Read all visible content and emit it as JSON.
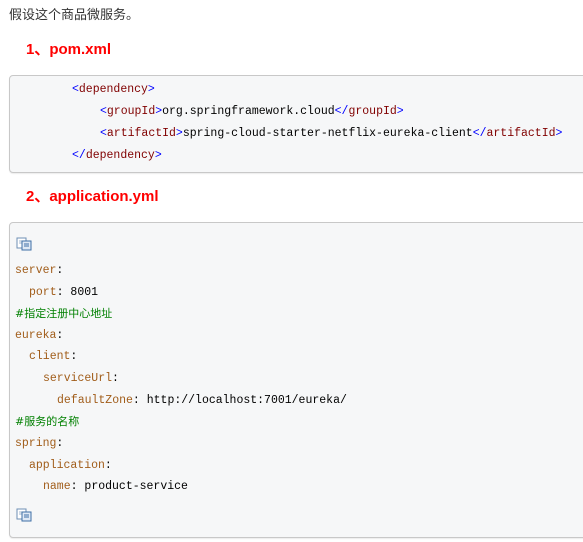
{
  "intro": "假设这个商品微服务。",
  "sections": [
    {
      "title": "1、pom.xml"
    },
    {
      "title": "2、application.yml"
    }
  ],
  "pom": {
    "dependency_tag": "dependency",
    "groupId_tag": "groupId",
    "groupId_value": "org.springframework.cloud",
    "artifactId_tag": "artifactId",
    "artifactId_value": "spring-cloud-starter-netflix-eureka-client"
  },
  "yml": {
    "server_key": "server",
    "port_key": "port",
    "port_value": "8001",
    "comment_registry": "#指定注册中心地址",
    "eureka_key": "eureka",
    "client_key": "client",
    "serviceUrl_key": "serviceUrl",
    "defaultZone_key": "defaultZone",
    "defaultZone_value": "http://localhost:7001/eureka/",
    "comment_service_name": "#服务的名称",
    "spring_key": "spring",
    "application_key": "application",
    "name_key": "name",
    "name_value": "product-service"
  },
  "icons": {
    "copy_top": "copy-code-icon",
    "copy_bottom": "copy-code-icon"
  },
  "colors": {
    "section_title": "#ff0000",
    "xml_bracket": "#0000ff",
    "xml_tag": "#800000",
    "yml_key": "#a15d1a",
    "yml_comment": "#008000",
    "code_background": "#f6f7f8"
  }
}
